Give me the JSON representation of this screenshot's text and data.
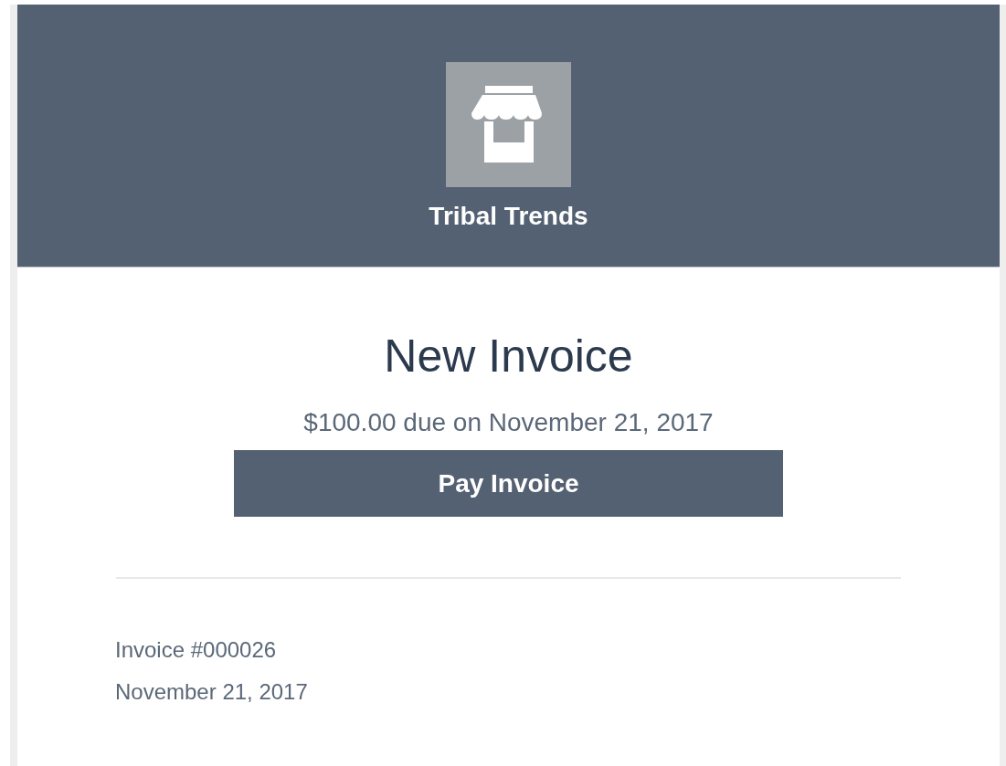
{
  "header": {
    "store_name": "Tribal Trends"
  },
  "invoice": {
    "title": "New Invoice",
    "due_line": "$100.00 due on November 21, 2017",
    "pay_button": "Pay Invoice",
    "number": "Invoice #000026",
    "date": "November 21, 2017"
  }
}
